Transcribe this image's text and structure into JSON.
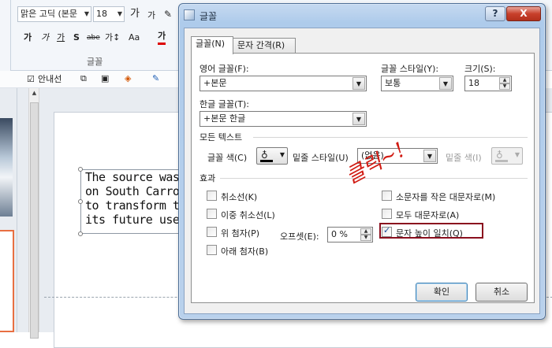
{
  "ribbon": {
    "font_name": "맑은 고딕 (본문",
    "font_size": "18",
    "grow_font": "가",
    "shrink_font": "가",
    "bold": "가",
    "italic": "가",
    "underline": "가",
    "shadow": "S",
    "strike": "abe",
    "spacing": "가↕",
    "change_case": "Aa",
    "font_color": "가",
    "group_label": "글꼴",
    "guides_label": "안내선"
  },
  "slide": {
    "text_lines": [
      "The source was a",
      "on South Carroli",
      "to transform the",
      "its future use as"
    ]
  },
  "dialog": {
    "title": "글꼴",
    "help": "?",
    "close": "X",
    "tabs": [
      "글꼴(N)",
      "문자 간격(R)"
    ],
    "latin_font_label": "영어 글꼴(F):",
    "latin_font_value": "+본문",
    "style_label": "글꼴 스타일(Y):",
    "style_value": "보통",
    "size_label": "크기(S):",
    "size_value": "18",
    "asian_font_label": "한글 글꼴(T):",
    "asian_font_value": "+본문 한글",
    "all_text_section": "모든 텍스트",
    "font_color_label": "글꼴 색(C)",
    "underline_style_label": "밑줄 스타일(U)",
    "underline_style_value": "(없음)",
    "underline_color_label": "밑줄 색(I)",
    "effects_section": "효과",
    "effects_left": [
      {
        "label": "취소선(K)",
        "checked": false
      },
      {
        "label": "이중 취소선(L)",
        "checked": false
      },
      {
        "label": "위 첨자(P)",
        "checked": false
      },
      {
        "label": "아래 첨자(B)",
        "checked": false
      }
    ],
    "offset_label": "오프셋(E):",
    "offset_value": "0 %",
    "effects_right": [
      {
        "label": "소문자를 작은 대문자로(M)",
        "checked": false
      },
      {
        "label": "모두 대문자로(A)",
        "checked": false
      },
      {
        "label": "문자 높이 일치(Q)",
        "checked": true
      }
    ],
    "ok": "확인",
    "cancel": "취소"
  },
  "annotation": {
    "text": "클릭~!",
    "color": "#d11a12"
  },
  "colors": {
    "highlight": "#8a0f1e",
    "dialog_frame": "#b9d1ec",
    "selected_slide_border": "#e86f42"
  }
}
